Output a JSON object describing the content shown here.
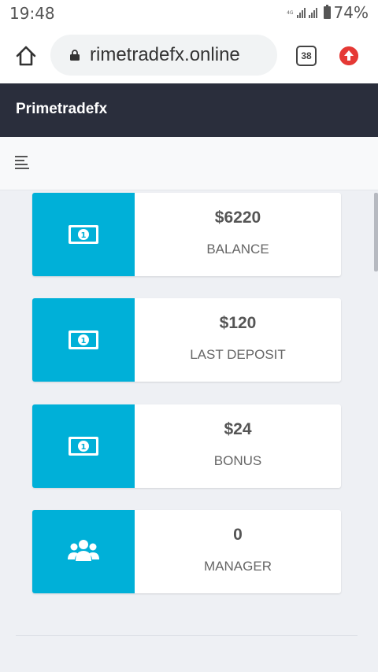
{
  "status_bar": {
    "time": "19:48",
    "network_tag": "4G",
    "battery_percent": "74%"
  },
  "browser": {
    "url": "rimetradefx.online",
    "tabs_count": "38",
    "home_icon": "home-icon",
    "lock_icon": "lock-icon",
    "update_icon": "arrow-up-icon"
  },
  "header": {
    "brand": "Primetradefx"
  },
  "toolbar": {
    "menu_icon": "hamburger-menu-icon"
  },
  "cards": [
    {
      "value": "$6220",
      "label": "BALANCE",
      "icon": "money-bill-icon"
    },
    {
      "value": "$120",
      "label": "LAST DEPOSIT",
      "icon": "money-bill-icon"
    },
    {
      "value": "$24",
      "label": "BONUS",
      "icon": "money-bill-icon"
    },
    {
      "value": "0",
      "label": "MANAGER",
      "icon": "users-icon"
    }
  ],
  "colors": {
    "accent": "#00b0d8",
    "header_bg": "#2a2e3c",
    "page_bg": "#eef0f4"
  }
}
